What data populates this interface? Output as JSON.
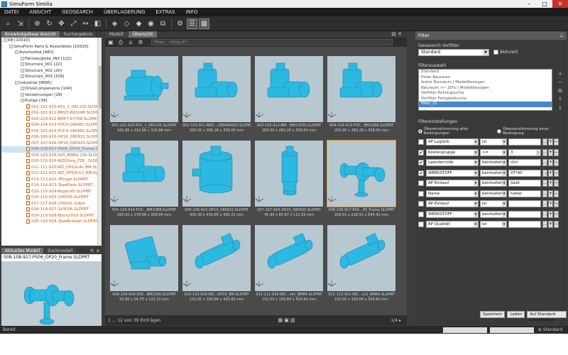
{
  "window": {
    "title": "SimuForm Similia"
  },
  "menu": [
    "DATEI",
    "ANSICHT",
    "GEOSEARCH",
    "ÜBERLAGERUNG",
    "EXTRAS",
    "INFO"
  ],
  "left": {
    "tabs": [
      "KnowledgeBase Ansicht",
      "Suchergebnis"
    ],
    "tree": [
      {
        "indent": 0,
        "kind": "folder",
        "text": "KB [10310]"
      },
      {
        "indent": 1,
        "kind": "folder",
        "text": "SimuForm Parts & Assemblies [10310]"
      },
      {
        "indent": 2,
        "kind": "folder",
        "text": "Automotive [482]"
      },
      {
        "indent": 3,
        "kind": "folder",
        "text": "Fahrzeugteile_INX [122]"
      },
      {
        "indent": 3,
        "kind": "folder",
        "text": "Structure_001 [22]"
      },
      {
        "indent": 3,
        "kind": "folder",
        "text": "Structure_002 [20]"
      },
      {
        "indent": 3,
        "kind": "folder",
        "text": "Structure_003 [318]"
      },
      {
        "indent": 2,
        "kind": "folder",
        "text": "Industrial [9695]"
      },
      {
        "indent": 3,
        "kind": "folder",
        "text": "DriveComponents [104]"
      },
      {
        "indent": 3,
        "kind": "folder",
        "text": "Verzahnungen [18]"
      },
      {
        "indent": 3,
        "kind": "folder",
        "text": "Pumps [39]"
      },
      {
        "indent": 4,
        "kind": "file",
        "text": "001-101-910-P01_1_081105.SLDPRT"
      },
      {
        "indent": 4,
        "kind": "file",
        "text": "002-102-911-BM25-663298.SLDPRT"
      },
      {
        "indent": 4,
        "kind": "file",
        "text": "003-103-912-BMP7-67708.SLDPRT"
      },
      {
        "indent": 4,
        "kind": "file",
        "text": "004-104-913-FOC4-186482.SLDPRT"
      },
      {
        "indent": 4,
        "kind": "file",
        "text": "005-105-914-FOC4-186482.SLDPRT"
      },
      {
        "indent": 4,
        "kind": "file",
        "text": "006-106-915-OP10_080922.SLDPRT"
      },
      {
        "indent": 4,
        "kind": "file",
        "text": "007-107-916-OP20_080920.SLDPRT"
      },
      {
        "indent": 4,
        "kind": "file",
        "text": "008-108-917-PS06_OP20_Frame.SLDPRT",
        "selected": true
      },
      {
        "indent": 4,
        "kind": "file",
        "text": "009-109-918-S05_BM84-156.SLDPRT"
      },
      {
        "indent": 4,
        "kind": "file",
        "text": "010-110-919-WZ02org_FZK_.SLDPRT"
      },
      {
        "indent": 4,
        "kind": "file",
        "text": "011-111-920-WZ_OP10v4z_BM.SLDPRT"
      },
      {
        "indent": 4,
        "kind": "file",
        "text": "012-112-921-WZ_OP10v12_BM.SLDPRT"
      },
      {
        "indent": 4,
        "kind": "file",
        "text": "013-113-922-3Finger.SLDPRT"
      },
      {
        "indent": 4,
        "kind": "file",
        "text": "014-114-923-3JawPlate.SLDPRT"
      },
      {
        "indent": 4,
        "kind": "file",
        "text": "015-115-924-Bogen90.SLDPRT"
      },
      {
        "indent": 4,
        "kind": "file",
        "text": "016-116-925-145005.SLDPRT"
      },
      {
        "indent": 4,
        "kind": "file",
        "text": "017-117-926-145001.sldprt"
      },
      {
        "indent": 4,
        "kind": "file",
        "text": "018-118-927-143006.SLDPRT"
      },
      {
        "indent": 4,
        "kind": "file",
        "text": "019-119-928-Block2010.SLDPRT"
      },
      {
        "indent": 4,
        "kind": "file",
        "text": "020-120-929-3JawBracket.SLDPRT"
      }
    ]
  },
  "leftbottom": {
    "tabs": [
      "Aktuelles Modell",
      "Suchmodell"
    ],
    "filename": "008-108-917-PS06_OP20_Frame.SLDPRT"
  },
  "center": {
    "tabs": [
      "Modell",
      "Übersicht"
    ],
    "filter_placeholder": "Filter... <Strg+F>",
    "cards": [
      {
        "name": "001-101-910-P01_1_081105.SLDPRT",
        "dims": "181.86 x 210.96 x 315.98 mm",
        "shape": "motor"
      },
      {
        "name": "002-102-911-BM2...289490002.SLDPRT",
        "dims": "265.00 x 280.28 x 358.00 mm",
        "shape": "gearmotor"
      },
      {
        "name": "003-103-912-BM...BM17000.SLDPRT",
        "dims": "265.00 x 280.28 x 358.00 mm",
        "shape": "gearmotor"
      },
      {
        "name": "004-104-913-FOC...BM10BR.SLDPRT",
        "dims": "265.00 x 280.28 x 358.00 mm",
        "shape": "gearmotor"
      },
      {
        "name": "005-105-914-FOC...BM10BR.SLDPRT",
        "dims": "265.00 x 278.68 x 358.00 mm",
        "shape": "gearmotor"
      },
      {
        "name": "006-106-915-OP10_080922.SLDPRT",
        "dims": "406.30 x 430.85 x 495.21 mm",
        "shape": "tank"
      },
      {
        "name": "007-107-916-OP20_080920.SLDPRT",
        "dims": "45.94 x 65.97 x 111.00 mm",
        "shape": "pump"
      },
      {
        "name": "008-108-917-PS0...20_Frame.SLDPRT",
        "dims": "209.51 x 228.55 x 694.42 mm",
        "shape": "valve",
        "selected": true
      },
      {
        "name": "009-109-918-S05...BM3000.SLDPRT",
        "dims": "53.80 x 54.75 x 122.32 mm",
        "shape": "block"
      },
      {
        "name": "010-110-919-WZ...OP10_BM.SLDPRT",
        "dims": "152.00 x 193.84 x 429.83 mm",
        "shape": "cylinder"
      },
      {
        "name": "011-111-920-WZ...v4c_BM84.SLDPRT",
        "dims": "152.00 x 193.84 x 429.83 mm",
        "shape": "cylinder"
      },
      {
        "name": "012-112-921-WZ...v12_BM84.SLDPRT",
        "dims": "152.00 x 193.84 x 429.83 mm",
        "shape": "cylinder"
      }
    ],
    "count_text": "1 ... 12 von 39 Einträgen",
    "page_text": "1/4"
  },
  "right": {
    "title": "Filter",
    "preset_label": "Geosearch Vorfilter",
    "preset_value": "Standard",
    "aktiv_label": "Aktiviert",
    "list_label": "Filterauswahl",
    "filters": [
      "Standard",
      "freier Bauraum",
      "fester Bauraum | Modellbezogen",
      "Bauraum +/- 20% | Modellbezogen",
      "Vorfilter Rohlingsuche",
      "Vorfilter Fertigteilsuche",
      "Filter_01"
    ],
    "selected_filter": "Filter_01",
    "settings_label": "Filtereinstellungen",
    "radio_all": "Übereinstimmung aller Bedingungen",
    "radio_one": "Übereinstimmung einer Bedingung",
    "conditions": [
      {
        "checked": false,
        "field": "AP Logistik",
        "op": "ist",
        "value": "",
        "kind": "text"
      },
      {
        "checked": true,
        "field": "Kostengruppe",
        "op": ">=",
        "value": "3",
        "kind": "spin"
      },
      {
        "checked": true,
        "field": "Laendercode",
        "op": "beinhaltet",
        "value": "chn",
        "kind": "text"
      },
      {
        "checked": true,
        "field": "WERKSTOFF",
        "op": "beinhaltet",
        "value": "ST*40",
        "kind": "text"
      },
      {
        "checked": false,
        "field": "AP Einkauf",
        "op": "beinhaltet",
        "value": "Geld",
        "kind": "text"
      },
      {
        "checked": false,
        "field": "Name",
        "op": "beinhaltet",
        "value": "halter",
        "kind": "text"
      },
      {
        "checked": false,
        "field": "AP Einkauf",
        "op": "ist",
        "value": "",
        "kind": "text"
      },
      {
        "checked": false,
        "field": "WERKSTOFF",
        "op": "beinhaltet",
        "value": "",
        "kind": "text"
      },
      {
        "checked": false,
        "field": "AP Qualität",
        "op": "ist",
        "value": "",
        "kind": "text"
      }
    ],
    "btn_save": "Speichern",
    "btn_load": "Laden",
    "btn_reset": "Auf Standard zurücksetzen"
  },
  "status": {
    "text": "Bereit",
    "lang": "Standard"
  },
  "colors": {
    "model": "#2cb8e0",
    "model_dark": "#1a86a8",
    "preview_bg": "#b8c8d0",
    "selection": "#e08b2c",
    "file_text": "#c25a0c"
  }
}
